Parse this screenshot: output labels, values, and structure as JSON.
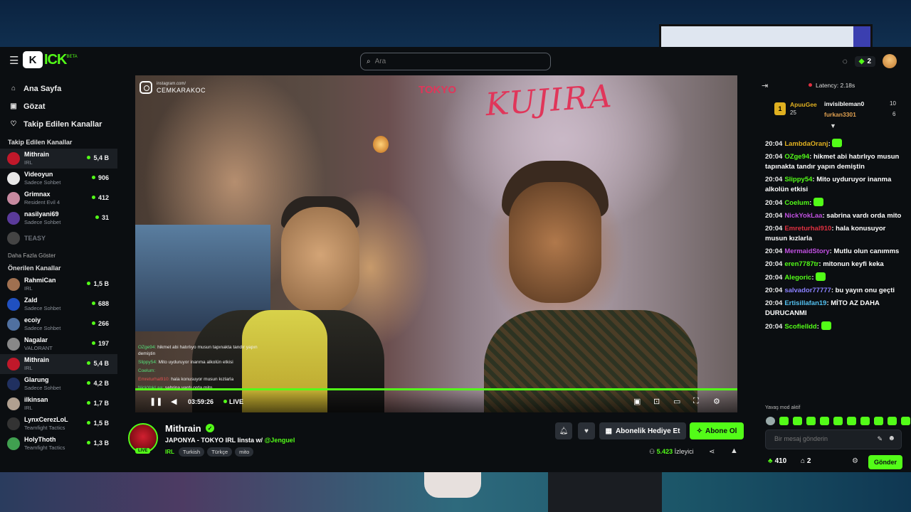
{
  "topbar": {
    "logo_letter": "K",
    "logo_text": "ICK",
    "logo_beta": "BETA",
    "search_placeholder": "Ara",
    "coins": "2"
  },
  "nav": [
    {
      "label": "Ana Sayfa",
      "icon": "home-icon",
      "glyph": "⌂"
    },
    {
      "label": "Gözat",
      "icon": "browse-icon",
      "glyph": "▣"
    },
    {
      "label": "Takip Edilen Kanallar",
      "icon": "heart-icon",
      "glyph": "♡"
    }
  ],
  "followed": {
    "title": "Takip Edilen Kanallar",
    "channels": [
      {
        "name": "Mithrain",
        "category": "IRL",
        "viewers": "5,4 B",
        "color": "#c0182a"
      },
      {
        "name": "Videoyun",
        "category": "Sadece Sohbet",
        "viewers": "906",
        "color": "#e8e8e8"
      },
      {
        "name": "Grimnax",
        "category": "Resident Evil 4",
        "viewers": "412",
        "color": "#c78aa0"
      },
      {
        "name": "nasilyani69",
        "category": "Sadece Sohbet",
        "viewers": "31",
        "color": "#5a3a9a"
      },
      {
        "name": "TEASY",
        "category": "",
        "viewers": "",
        "color": "#444"
      }
    ],
    "more": "Daha Fazla Göster"
  },
  "recommended": {
    "title": "Önerilen Kanallar",
    "channels": [
      {
        "name": "RahmiCan",
        "category": "IRL",
        "viewers": "1,5 B",
        "color": "#a07050"
      },
      {
        "name": "Zald",
        "category": "Sadece Sohbet",
        "viewers": "688",
        "color": "#2050c0"
      },
      {
        "name": "ecoiy",
        "category": "Sadece Sohbet",
        "viewers": "266",
        "color": "#5070a0"
      },
      {
        "name": "Nagalar",
        "category": "VALORANT",
        "viewers": "197",
        "color": "#888"
      },
      {
        "name": "Mithrain",
        "category": "IRL",
        "viewers": "5,4 B",
        "color": "#c0182a"
      },
      {
        "name": "Glarung",
        "category": "Sadece Sohbet",
        "viewers": "4,2 B",
        "color": "#203060"
      },
      {
        "name": "ilkinsan",
        "category": "IRL",
        "viewers": "1,7 B",
        "color": "#b0a090"
      },
      {
        "name": "LynxCerezLoL",
        "category": "Teamfight Tactics",
        "viewers": "1,5 B",
        "color": "#333"
      },
      {
        "name": "HolyThoth",
        "category": "Teamfight Tactics",
        "viewers": "1,3 B",
        "color": "#40a050"
      }
    ]
  },
  "player": {
    "graffiti": "KUJIRA",
    "tokyo": "TOKYO",
    "insta_top": "instagram.com/",
    "insta_handle": "CEMKARAKOC",
    "overlay_chat": [
      {
        "user": "OZge94:",
        "text": "hikmet abi hatırlıyo musun tapınakta tandır yapın demiştin",
        "cls": "g"
      },
      {
        "user": "Slippy54:",
        "text": "Mito uyduruyor inanma alkolün etkisi",
        "cls": "g"
      },
      {
        "user": "Coelum:",
        "text": "",
        "cls": "g"
      },
      {
        "user": "Emreturhal910:",
        "text": "hala konusuyor musun kızlarla",
        "cls": "p"
      },
      {
        "user": "NickYokLaa:",
        "text": "sabrina vardı orda mito",
        "cls": "g"
      }
    ],
    "time": "03:59:26",
    "live_label": "LIVE",
    "progress": 1.0
  },
  "stream": {
    "channel": "Mithrain",
    "title_text": "JAPONYA - TOKYO IRL Iinsta w/ ",
    "title_mention": "@Jenguel",
    "category": "IRL",
    "tags": [
      "Turkish",
      "Türkçe",
      "mito"
    ],
    "live_badge": "LIVE",
    "gift_label": "Abonelik Hediye Et",
    "subscribe_label": "Abone Ol",
    "viewers_count": "5.423",
    "viewers_label": "İzleyici"
  },
  "chat": {
    "latency": "Latency: 2.18s",
    "leaderboard": {
      "first_name": "ApuuGee",
      "first_count": "25",
      "first_rank": "1",
      "second_name": "invisibleman0",
      "second_count": "10",
      "third_name": "furkan3301",
      "third_count": "6"
    },
    "messages": [
      {
        "time": "20:04",
        "user": "LambdaOranj",
        "color": "#e0b020",
        "text": ""
      },
      {
        "time": "20:04",
        "user": "OZge94",
        "color": "#53fc18",
        "text": "hikmet abi hatırlıyo musun tapınakta tandır yapın demiştin"
      },
      {
        "time": "20:04",
        "user": "Slippy54",
        "color": "#53fc18",
        "text": "Mito uyduruyor inanma alkolün etkisi"
      },
      {
        "time": "20:04",
        "user": "Coelum",
        "color": "#53fc18",
        "text": ""
      },
      {
        "time": "20:04",
        "user": "NickYokLaa",
        "color": "#c050e0",
        "text": "sabrina vardı orda mito"
      },
      {
        "time": "20:04",
        "user": "Emreturhal910",
        "color": "#e03040",
        "text": "hala konusuyor musun kızlarla"
      },
      {
        "time": "20:04",
        "user": "MermaidStory",
        "color": "#c050e0",
        "text": "Mutlu olun canımms"
      },
      {
        "time": "20:04",
        "user": "eren7787tr",
        "color": "#53fc18",
        "text": "mitonun keyfi keka"
      },
      {
        "time": "20:04",
        "user": "Alegoric",
        "color": "#53fc18",
        "text": ""
      },
      {
        "time": "20:04",
        "user": "salvador77777",
        "color": "#8a80ff",
        "text": "bu yayın onu geçti"
      },
      {
        "time": "20:04",
        "user": "Ertisillafan19",
        "color": "#53c0f0",
        "text": "MİTO AZ DAHA DURUCANMI"
      },
      {
        "time": "20:04",
        "user": "Scofielldd",
        "color": "#53fc18",
        "text": ""
      }
    ],
    "slow_mode": "Yavaş mod aktif",
    "input_placeholder": "Bir mesaj gönderin",
    "points": "410",
    "points2": "2",
    "send_label": "Gönder"
  }
}
